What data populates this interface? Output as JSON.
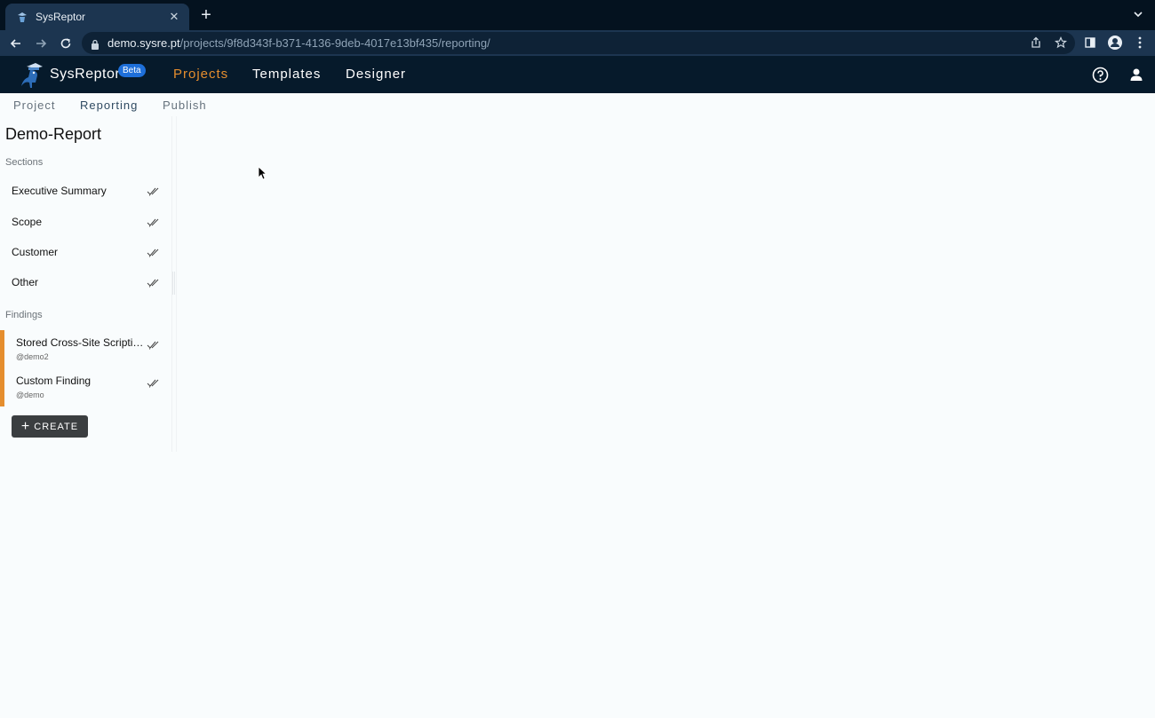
{
  "browser": {
    "tab_title": "SysReptor",
    "new_tab": "+",
    "url_host": "demo.sysre.pt",
    "url_path": "/projects/9f8d343f-b371-4136-9deb-4017e13bf435/reporting/"
  },
  "appbar": {
    "brand": "SysReptor",
    "beta": "Beta",
    "nav": [
      "Projects",
      "Templates",
      "Designer"
    ],
    "active_nav": "Projects",
    "accent": "#e58e2e"
  },
  "subtabs": [
    "Project",
    "Reporting",
    "Publish"
  ],
  "sidebar": {
    "project_title": "Demo-Report",
    "sections_label": "Sections",
    "sections": [
      {
        "label": "Executive Summary"
      },
      {
        "label": "Scope"
      },
      {
        "label": "Customer"
      },
      {
        "label": "Other"
      }
    ],
    "findings_label": "Findings",
    "findings": [
      {
        "label": "Stored Cross-Site Scripting...",
        "user": "@demo2"
      },
      {
        "label": "Custom Finding",
        "user": "@demo"
      }
    ],
    "create_label": "CREATE"
  }
}
